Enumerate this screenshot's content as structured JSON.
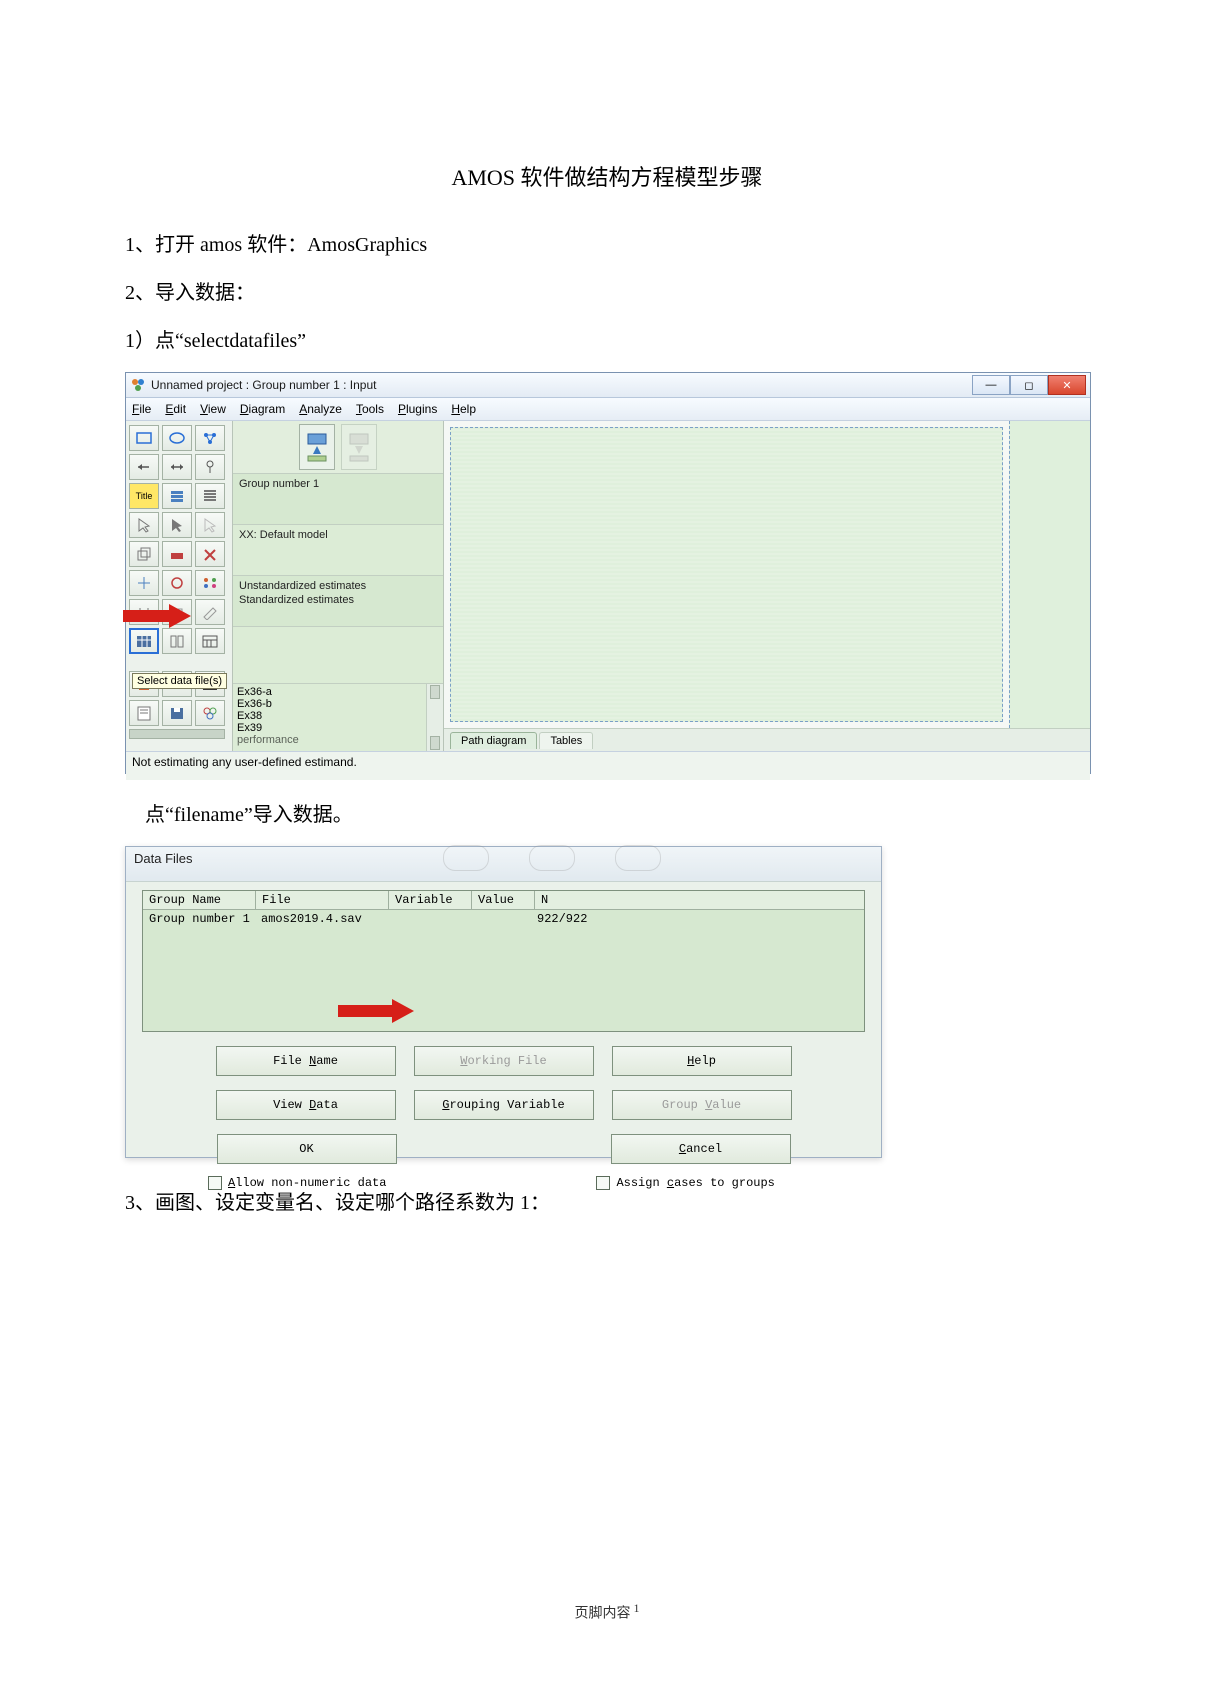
{
  "doc": {
    "title": "AMOS 软件做结构方程模型步骤",
    "line1a": "1、打开 ",
    "line1b": "amos",
    "line1c": " 软件：",
    "line1d": "AmosGraphics",
    "line2": "2、导入数据：",
    "line3a": "1）点“",
    "line3b": "selectdatafiles",
    "line3c": "”",
    "line4a": "点“",
    "line4b": "filename",
    "line4c": "”导入数据。",
    "line5": "3、画图、设定变量名、设定哪个路径系数为 1：",
    "footer_label": "页脚内容",
    "footer_page": "1"
  },
  "amos": {
    "window_title": "Unnamed project : Group number 1 : Input",
    "menu": {
      "file": "File",
      "edit": "Edit",
      "view": "View",
      "diagram": "Diagram",
      "analyze": "Analyze",
      "tools": "Tools",
      "plugins": "Plugins",
      "help": "Help"
    },
    "group_label": "Group number 1",
    "model_label": "XX: Default model",
    "estimates": {
      "unstd": "Unstandardized estimates",
      "std": "Standardized estimates"
    },
    "tooltip": "Select data file(s)",
    "files": [
      "Ex36-a",
      "Ex36-b",
      "Ex38",
      "Ex39",
      "performance"
    ],
    "tabs": {
      "path": "Path diagram",
      "tables": "Tables"
    },
    "status": "Not estimating any user-defined estimand.",
    "winbtn": {
      "min": "—",
      "max": "◻",
      "close": "✕"
    }
  },
  "datafiles": {
    "title": "Data Files",
    "col": {
      "group": "Group Name",
      "file": "File",
      "variable": "Variable",
      "value": "Value",
      "n": "N"
    },
    "row": {
      "group": "Group number 1",
      "file": "amos2019.4.sav",
      "n": "922/922"
    },
    "btn": {
      "filename": "File Name",
      "working": "Working File",
      "help": "Help",
      "viewdata": "View Data",
      "grouping": "Grouping Variable",
      "groupval": "Group Value",
      "ok": "OK",
      "cancel": "Cancel"
    },
    "chk": {
      "allow": "Allow non-numeric data",
      "assign": "Assign cases to groups"
    }
  }
}
